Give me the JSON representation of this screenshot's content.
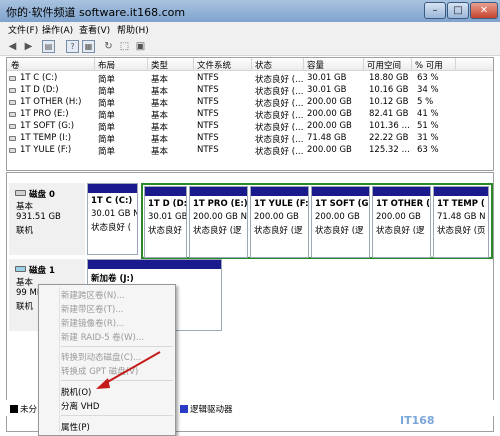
{
  "window": {
    "title": "你的·软件频道 software.it168.com"
  },
  "menu": {
    "items": [
      "文件(F)",
      "操作(A)",
      "查看(V)",
      "帮助(H)"
    ]
  },
  "table": {
    "headers": [
      "卷",
      "布局",
      "类型",
      "文件系统",
      "状态",
      "容量",
      "可用空间",
      "% 可用"
    ],
    "rows": [
      [
        "1T C (C:)",
        "简单",
        "基本",
        "NTFS",
        "状态良好 (…",
        "30.01 GB",
        "18.80 GB",
        "63 %"
      ],
      [
        "1T D (D:)",
        "简单",
        "基本",
        "NTFS",
        "状态良好 (…",
        "30.01 GB",
        "10.16 GB",
        "34 %"
      ],
      [
        "1T OTHER (H:)",
        "简单",
        "基本",
        "NTFS",
        "状态良好 (…",
        "200.00 GB",
        "10.12 GB",
        "5 %"
      ],
      [
        "1T PRO (E:)",
        "简单",
        "基本",
        "NTFS",
        "状态良好 (…",
        "200.00 GB",
        "82.41 GB",
        "41 %"
      ],
      [
        "1T SOFT (G:)",
        "简单",
        "基本",
        "NTFS",
        "状态良好 (…",
        "200.00 GB",
        "101.36 …",
        "51 %"
      ],
      [
        "1T TEMP (I:)",
        "简单",
        "基本",
        "NTFS",
        "状态良好 (…",
        "71.48 GB",
        "22.22 GB",
        "31 %"
      ],
      [
        "1T YULE (F:)",
        "简单",
        "基本",
        "NTFS",
        "状态良好 (…",
        "200.00 GB",
        "125.32 …",
        "63 %"
      ]
    ]
  },
  "disk0": {
    "name": "磁盘 0",
    "type": "基本",
    "size": "931.51 GB",
    "status": "联机",
    "partitions": [
      {
        "name": "1T C (C:)",
        "size": "30.01 GB N",
        "status": "状态良好 ("
      },
      {
        "name": "1T D (D:)",
        "size": "30.01 GB",
        "status": "状态良好"
      },
      {
        "name": "1T PRO (E:)",
        "size": "200.00 GB N",
        "status": "状态良好 (逻"
      },
      {
        "name": "1T YULE (F:)",
        "size": "200.00 GB",
        "status": "状态良好 (逻"
      },
      {
        "name": "1T SOFT (G",
        "size": "200.00 GB",
        "status": "状态良好 (逻"
      },
      {
        "name": "1T OTHER (",
        "size": "200.00 GB",
        "status": "状态良好 (逻"
      },
      {
        "name": "1T TEMP (",
        "size": "71.48 GB N",
        "status": "状态良好 (页"
      }
    ]
  },
  "disk1": {
    "name": "磁盘 1",
    "type": "基本",
    "size": "99 MB",
    "status": "联机",
    "partitions": [
      {
        "name": "新加卷 (J:)"
      }
    ]
  },
  "context_menu": {
    "items": [
      {
        "label": "新建跨区卷(N)...",
        "enabled": false
      },
      {
        "label": "新建带区卷(T)...",
        "enabled": false
      },
      {
        "label": "新建镜像卷(R)...",
        "enabled": false
      },
      {
        "label": "新建 RAID-5 卷(W)...",
        "enabled": false
      },
      {
        "label": "转换到动态磁盘(C)...",
        "enabled": false
      },
      {
        "label": "转换成 GPT 磁盘(V)",
        "enabled": false
      },
      {
        "label": "脱机(O)",
        "enabled": true
      },
      {
        "label": "分离 VHD",
        "enabled": true
      },
      {
        "label": "属性(P)",
        "enabled": true
      }
    ]
  },
  "legend": {
    "unallocated": "未分",
    "logical": "逻辑驱动器"
  },
  "watermark": "IT168"
}
